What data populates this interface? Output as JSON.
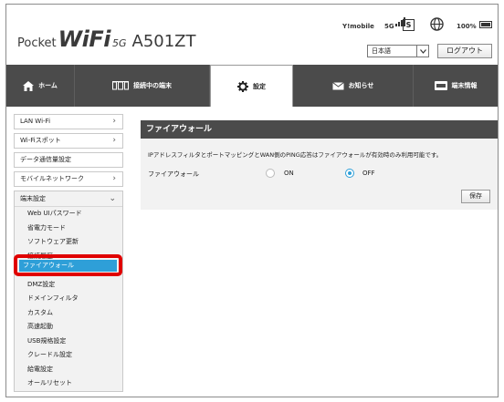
{
  "header": {
    "logo_part1": "Pocket",
    "logo_part2": "WiFi",
    "logo_part3": "5G",
    "logo_model": "A501ZT",
    "carrier": "Y!mobile",
    "network": "5G",
    "sim_label": "S",
    "battery": "100%",
    "language_selected": "日本語",
    "logout_label": "ログアウト"
  },
  "nav": {
    "tabs": [
      {
        "label": "ホーム",
        "icon": "home-icon"
      },
      {
        "label": "接続中の端末",
        "icon": "devices-icon"
      },
      {
        "label": "設定",
        "icon": "gear-icon"
      },
      {
        "label": "お知らせ",
        "icon": "mail-icon"
      },
      {
        "label": "端末情報",
        "icon": "device-info-icon"
      }
    ],
    "active_tab": "設定"
  },
  "sidebar": {
    "items": [
      {
        "label": "LAN Wi-Fi"
      },
      {
        "label": "Wi-Fiスポット"
      },
      {
        "label": "データ通信量設定"
      },
      {
        "label": "モバイルネットワーク"
      }
    ],
    "group": {
      "label": "端末設定",
      "items": [
        "Web UIパスワード",
        "省電力モード",
        "ソフトウェア更新",
        "接続履歴",
        "ファイアウォール",
        "DMZ設定",
        "ドメインフィルタ",
        "カスタム",
        "高速起動",
        "USB規格設定",
        "クレードル設定",
        "給電設定",
        "オールリセット"
      ],
      "selected": "ファイアウォール"
    }
  },
  "panel": {
    "title": "ファイアウォール",
    "note": "IPアドレスフィルタとポートマッピングとWAN側のPING応答はファイアウォールが有効時のみ利用可能です。",
    "field_label": "ファイアウォール",
    "option_on": "ON",
    "option_off": "OFF",
    "selected": "OFF",
    "save_label": "保存"
  },
  "colors": {
    "nav_bg": "#4b4b4b",
    "accent": "#2e9fd8",
    "highlight": "#e00000"
  }
}
